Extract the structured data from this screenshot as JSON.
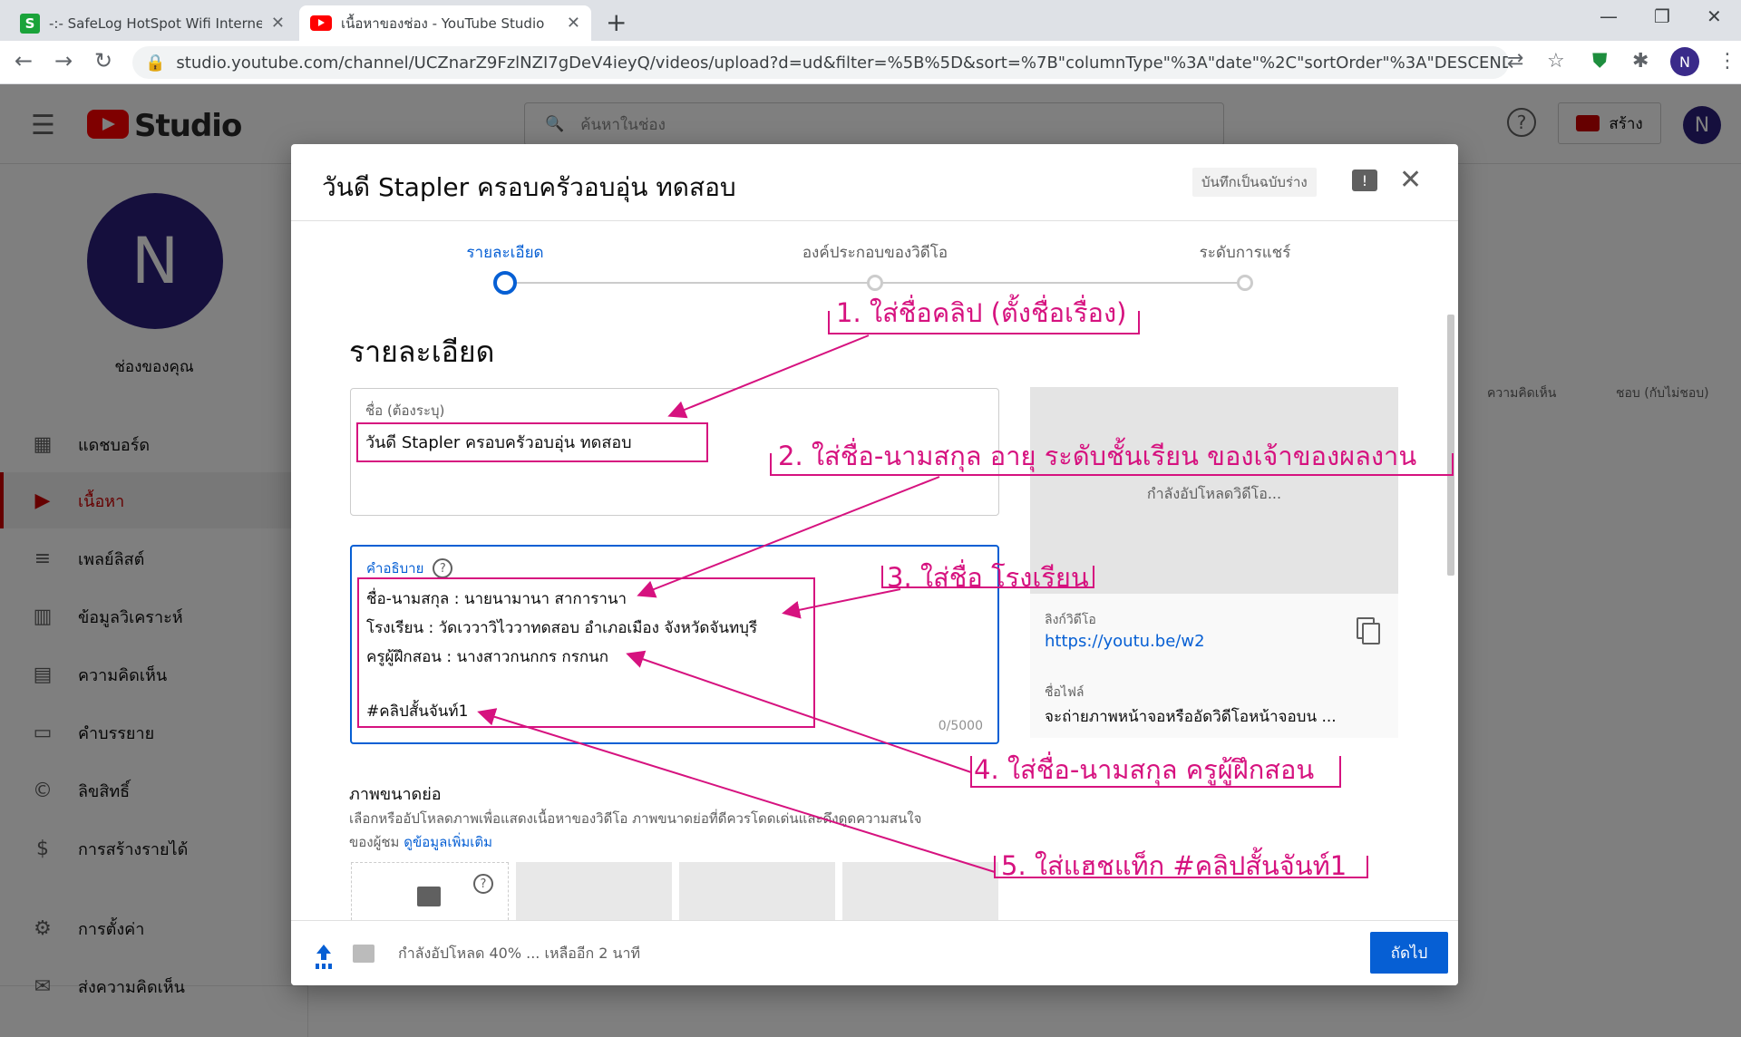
{
  "browser": {
    "tabs": [
      {
        "title": "-:- SafeLog HotSpot Wifi Internet",
        "fav": "S"
      },
      {
        "title": "เนื้อหาของช่อง - YouTube Studio"
      }
    ],
    "url": "studio.youtube.com/channel/UCZnarZ9FzlNZI7gDeV4ieyQ/videos/upload?d=ud&filter=%5B%5D&sort=%7B\"columnType\"%3A\"date\"%2C\"sortOrder\"%3A\"DESCENDING\"%7D",
    "profile_initial": "N"
  },
  "studio": {
    "brand": "Studio",
    "search_placeholder": "ค้นหาในช่อง",
    "create_label": "สร้าง",
    "avatar_initial": "N",
    "channel_initial": "N",
    "channel_label": "ช่องของคุณ",
    "sidebar": [
      {
        "label": "แดชบอร์ด",
        "icon": "dashboard-icon"
      },
      {
        "label": "เนื้อหา",
        "icon": "content-icon",
        "active": true
      },
      {
        "label": "เพลย์ลิสต์",
        "icon": "playlist-icon"
      },
      {
        "label": "ข้อมูลวิเคราะห์",
        "icon": "analytics-icon"
      },
      {
        "label": "ความคิดเห็น",
        "icon": "comments-icon"
      },
      {
        "label": "คำบรรยาย",
        "icon": "subtitles-icon"
      },
      {
        "label": "ลิขสิทธิ์",
        "icon": "copyright-icon"
      },
      {
        "label": "การสร้างรายได้",
        "icon": "monetization-icon"
      }
    ],
    "sidebar_bottom": [
      {
        "label": "การตั้งค่า",
        "icon": "settings-icon"
      },
      {
        "label": "ส่งความคิดเห็น",
        "icon": "feedback-icon"
      }
    ],
    "bg_columns": [
      "ความคิดเห็น",
      "ชอบ (กับไม่ชอบ)"
    ]
  },
  "dialog": {
    "title": "วันดี Stapler ครอบครัวอบอุ่น ทดสอบ",
    "draft_label": "บันทึกเป็นฉบับร่าง",
    "steps": [
      {
        "label": "รายละเอียด",
        "active": true
      },
      {
        "label": "องค์ประกอบของวิดีโอ"
      },
      {
        "label": "ระดับการแชร์"
      }
    ],
    "section_title": "รายละเอียด",
    "title_field": {
      "label": "ชื่อ (ต้องระบุ)",
      "value": "วันดี Stapler ครอบครัวอบอุ่น ทดสอบ"
    },
    "desc_field": {
      "label": "คำอธิบาย",
      "lines": [
        "ชื่อ-นามสกุล : นายนามานา สาการานา",
        "โรงเรียน : วัดเววาวิไววาทดสอบ อำเภอเมือง จังหวัดจันทบุรี",
        "ครูผู้ฝึกสอน : นางสาวกนกกร กรกนก",
        "#คลิปสั้นจันท์1"
      ],
      "counter": "0/5000"
    },
    "preview": {
      "uploading": "กำลังอัปโหลดวิดีโอ...",
      "link_label": "ลิงก์วิดีโอ",
      "link": "https://youtu.be/w2",
      "file_label": "ชื่อไฟล์",
      "file": "จะถ่ายภาพหน้าจอหรืออัดวิดีโอหน้าจอบน ..."
    },
    "thumbnail": {
      "heading": "ภาพขนาดย่อ",
      "desc1": "เลือกหรืออัปโหลดภาพเพื่อแสดงเนื้อหาของวิดีโอ ภาพขนาดย่อที่ดีควรโดดเด่นและดึงดูดความสนใจ",
      "desc2": "ของผู้ชม",
      "link": "ดูข้อมูลเพิ่มเติม"
    },
    "footer_status": "กำลังอัปโหลด 40% ... เหลืออีก 2 นาที",
    "upload_progress": 0.4,
    "next_label": "ถัดไป"
  },
  "annotations": [
    "1. ใส่ชื่อคลิป (ตั้งชื่อเรื่อง)",
    "2. ใส่ชื่อ-นามสกุล  อายุ  ระดับชั้นเรียน ของเจ้าของผลงาน",
    "3. ใส่ชื่อ โรงเรียน",
    "4. ใส่ชื่อ-นามสกุล  ครูผู้ฝึกสอน",
    "5. ใส่แฮชแท็ก  #คลิปสั้นจันท์1"
  ],
  "colors": {
    "annotation": "#d6127f",
    "accent": "#065fd4",
    "brand": "#ff0000"
  }
}
